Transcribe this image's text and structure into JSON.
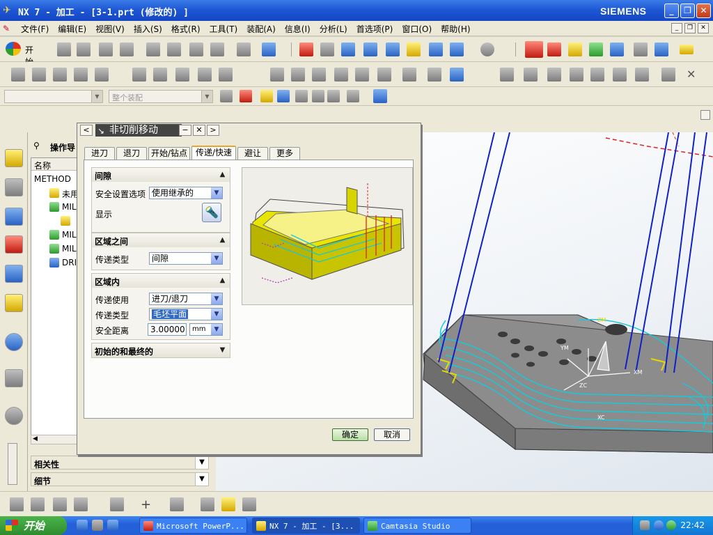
{
  "window": {
    "title": "NX 7 - 加工 - [3-1.prt  (修改的) ]",
    "brand": "SIEMENS",
    "min": "_",
    "restore": "❐",
    "close": "✕"
  },
  "menubar": {
    "items": [
      "文件(F)",
      "编辑(E)",
      "视图(V)",
      "插入(S)",
      "格式(R)",
      "工具(T)",
      "装配(A)",
      "信息(I)",
      "分析(L)",
      "首选项(P)",
      "窗口(O)",
      "帮助(H)"
    ]
  },
  "toolbar": {
    "start_label": "开始",
    "assembly_filter": "整个装配"
  },
  "navigator": {
    "title": "操作导",
    "column_name": "名称",
    "rows": [
      {
        "label": "METHOD",
        "indent": 0
      },
      {
        "label": "未用项",
        "indent": 1
      },
      {
        "label": "MILL_",
        "indent": 1
      },
      {
        "label": "",
        "indent": 2
      },
      {
        "label": "MILL_",
        "indent": 1
      },
      {
        "label": "MILL_",
        "indent": 1
      },
      {
        "label": "DRILI",
        "indent": 1
      }
    ],
    "panel_related": "相关性",
    "panel_details": "细节"
  },
  "dialog": {
    "title": "非切削移动",
    "tabs": [
      "进刀",
      "退刀",
      "开始/钻点",
      "传递/快速",
      "避让",
      "更多"
    ],
    "active_tab": 3,
    "section_clearance": "间隙",
    "label_safe_option": "安全设置选项",
    "value_safe_option": "使用继承的",
    "label_display": "显示",
    "section_between_regions": "区域之间",
    "label_transfer_type_1": "传递类型",
    "value_transfer_type_1": "间隙",
    "section_within_region": "区域内",
    "label_transfer_use": "传递使用",
    "value_transfer_use": "进刀/退刀",
    "label_transfer_type_2": "传递类型",
    "value_transfer_type_2": "毛坯平面",
    "label_safe_distance": "安全距离",
    "value_safe_distance": "3.00000",
    "value_unit": "mm",
    "section_initial_final": "初始的和最终的",
    "ok": "确定",
    "cancel": "取消"
  },
  "graphics": {
    "axis_labels": {
      "ym": "YM",
      "xm": "XM",
      "zm": "ZM",
      "xc": "XC",
      "zc": "ZC"
    }
  },
  "taskbar": {
    "start": "开始",
    "tasks": [
      "Microsoft PowerP...",
      "NX 7 - 加工 - [3...",
      "Camtasia Studio"
    ],
    "clock": "22:42"
  },
  "colors": {
    "title_blue": "#1c56d3",
    "part_gray": "#8a8a8a",
    "toolpath_cyan": "#19c8d8",
    "tool_blue": "#1020c8",
    "preview_yellow": "#e8e600"
  }
}
